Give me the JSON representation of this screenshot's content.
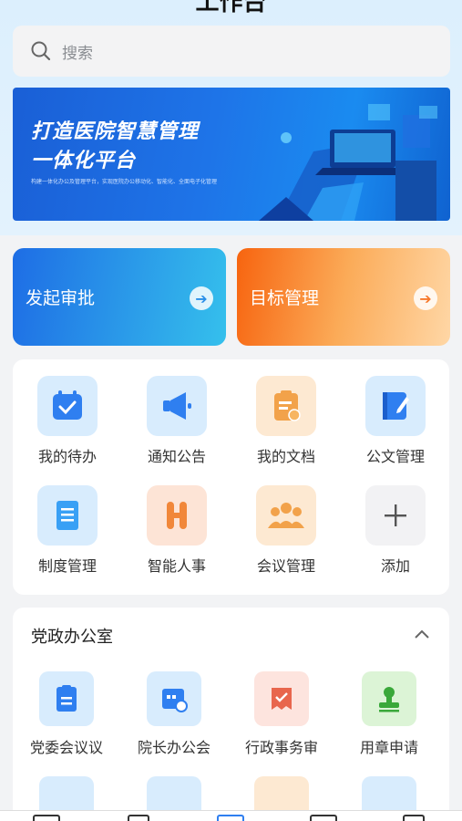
{
  "header": {
    "title": "工作台"
  },
  "search": {
    "placeholder": "搜索",
    "icon": "search-icon"
  },
  "banner": {
    "title_line1": "打造医院智慧管理",
    "title_line2": "一体化平台",
    "subtitle": "构建一体化办公及管理平台，实现医院办公移动化、智能化、全面电子化管理"
  },
  "actions": [
    {
      "label": "发起审批",
      "icon": "arrow-right-icon",
      "arrow": "➔"
    },
    {
      "label": "目标管理",
      "icon": "arrow-right-icon",
      "arrow": "➔"
    }
  ],
  "apps": [
    {
      "label": "我的待办",
      "icon": "calendar-check-icon"
    },
    {
      "label": "通知公告",
      "icon": "megaphone-icon"
    },
    {
      "label": "我的文档",
      "icon": "clipboard-icon"
    },
    {
      "label": "公文管理",
      "icon": "edit-book-icon"
    },
    {
      "label": "制度管理",
      "icon": "document-icon"
    },
    {
      "label": "智能人事",
      "icon": "h-letter-icon"
    },
    {
      "label": "会议管理",
      "icon": "people-group-icon"
    },
    {
      "label": "添加",
      "icon": "plus-icon"
    }
  ],
  "section": {
    "title": "党政办公室",
    "collapse_icon": "chevron-up-icon",
    "items": [
      {
        "label": "党委会议议",
        "icon": "meeting-clipboard-icon"
      },
      {
        "label": "院长办公会",
        "icon": "calendar-refresh-icon"
      },
      {
        "label": "行政事务审",
        "icon": "approval-ticket-icon"
      },
      {
        "label": "用章申请",
        "icon": "stamp-icon"
      }
    ]
  },
  "colors": {
    "approve_gradient": [
      "#1e6de5",
      "#35c0ec"
    ],
    "goal_gradient": [
      "#f7640f",
      "#ffd7a6"
    ],
    "banner": "#1e74e8"
  }
}
